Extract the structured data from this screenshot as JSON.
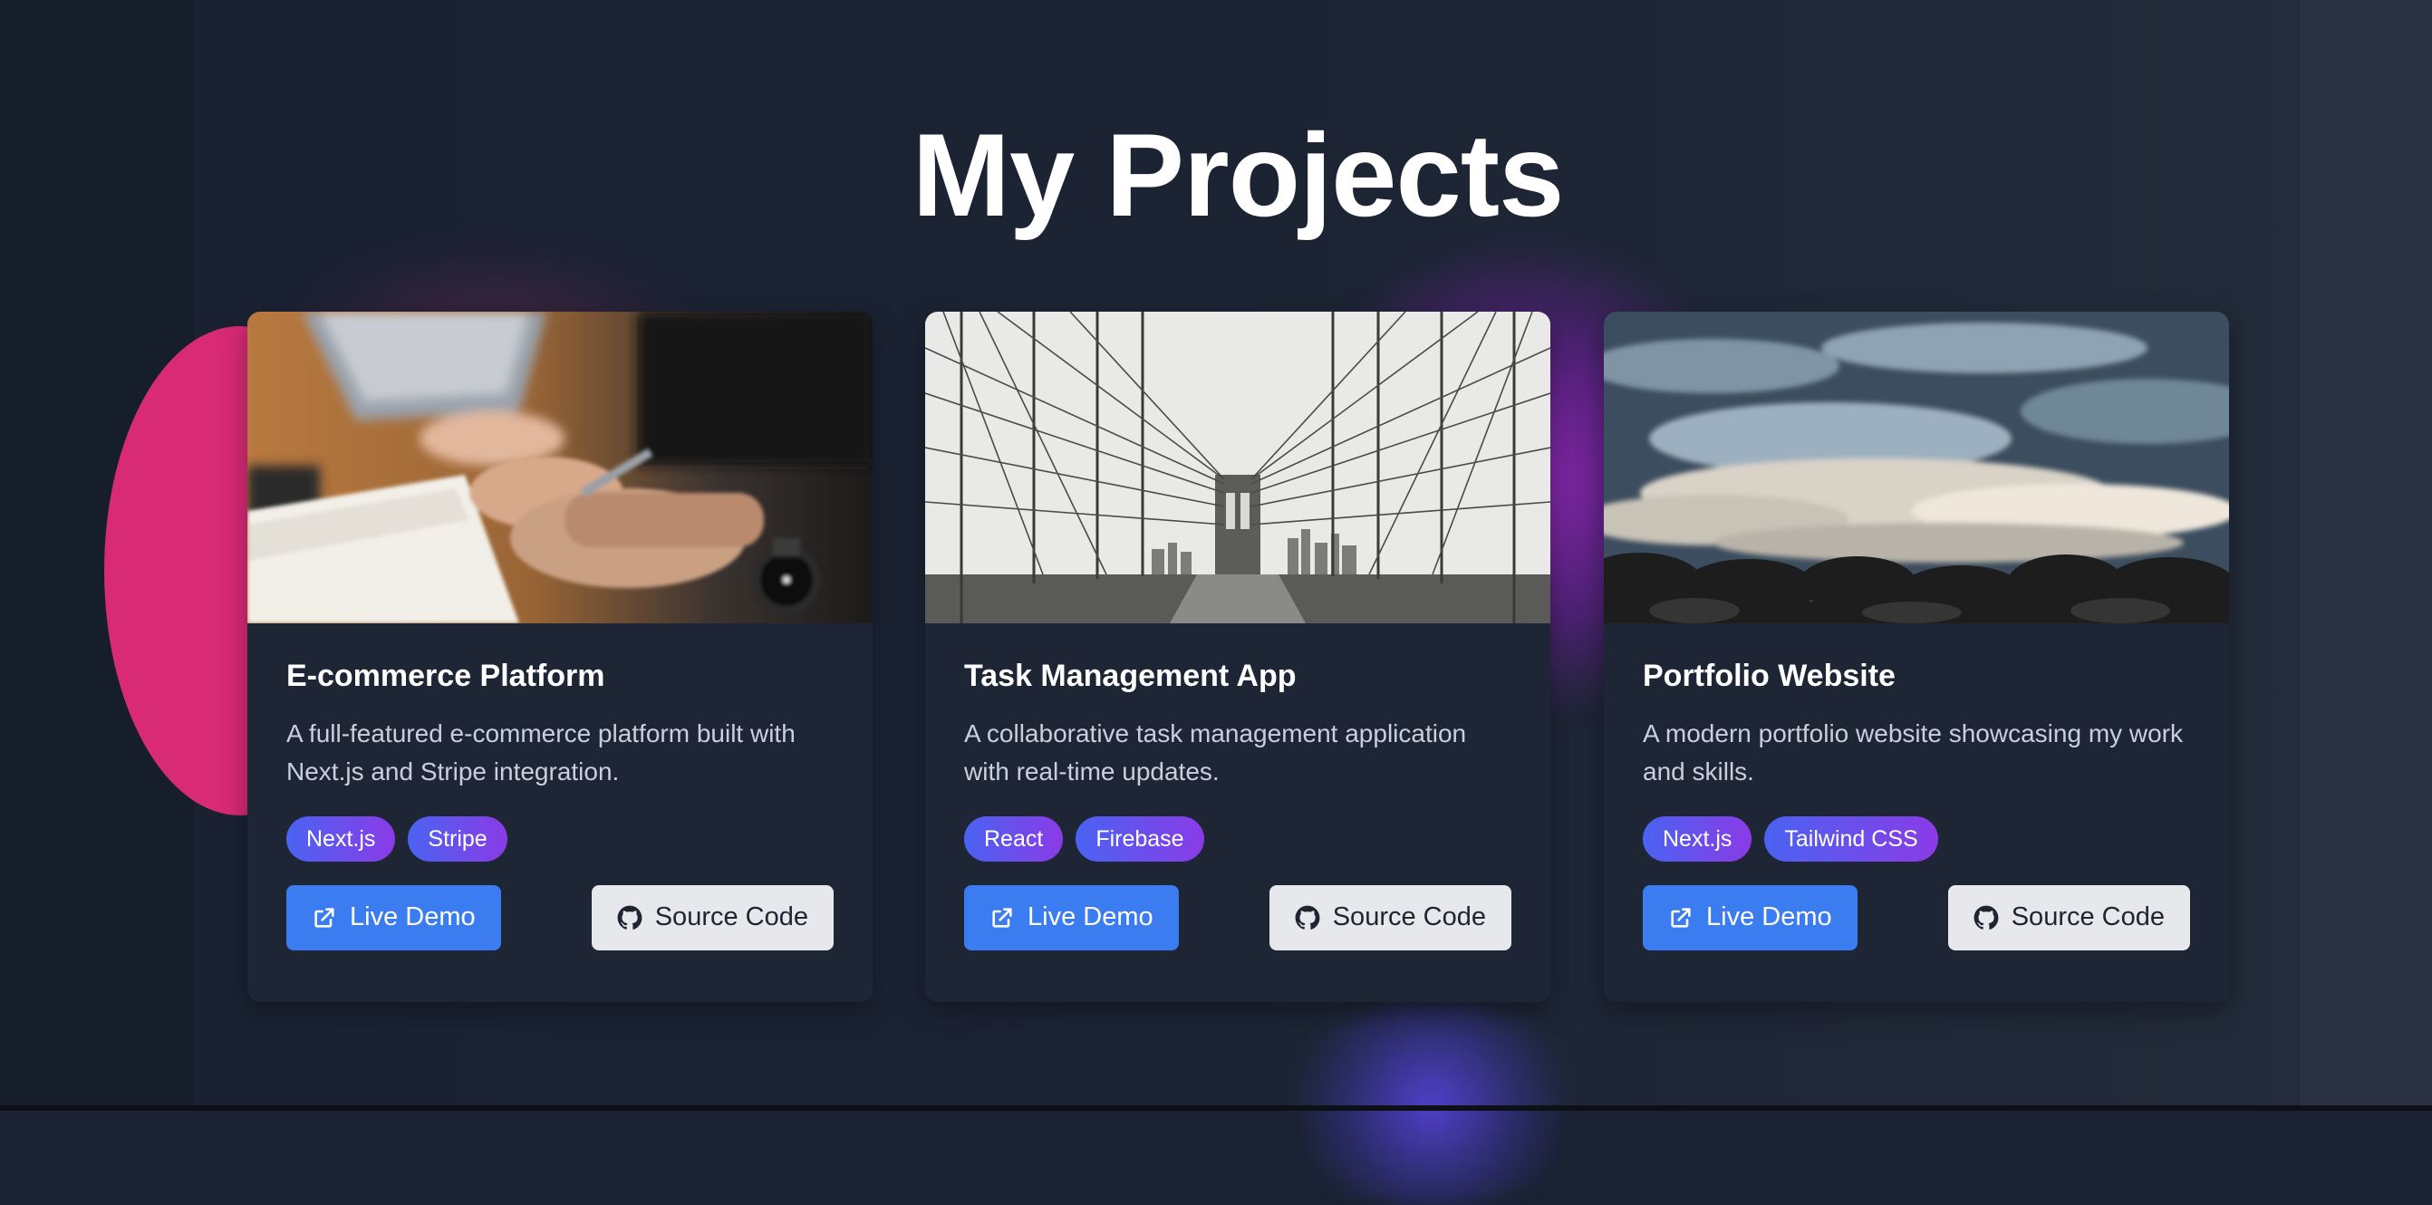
{
  "section": {
    "title": "My Projects"
  },
  "projects": [
    {
      "title": "E-commerce Platform",
      "description": "A full-featured e-commerce platform built with Next.js and Stripe integration.",
      "image_icon": "laptop-notebook-photo",
      "tags": [
        "Next.js",
        "Stripe"
      ],
      "live_demo_label": "Live Demo",
      "source_code_label": "Source Code"
    },
    {
      "title": "Task Management App",
      "description": "A collaborative task management application with real-time updates.",
      "image_icon": "suspension-bridge-photo",
      "tags": [
        "React",
        "Firebase"
      ],
      "live_demo_label": "Live Demo",
      "source_code_label": "Source Code"
    },
    {
      "title": "Portfolio Website",
      "description": "A modern portfolio website showcasing my work and skills.",
      "image_icon": "ocean-waves-photo",
      "tags": [
        "Next.js",
        "Tailwind CSS"
      ],
      "live_demo_label": "Live Demo",
      "source_code_label": "Source Code"
    }
  ],
  "icons": {
    "live_demo": "external-link-icon",
    "source_code": "github-icon"
  },
  "colors": {
    "background": "#1b2232",
    "card": "#1e2636",
    "primary_button": "#3b7cf0",
    "secondary_button": "#e6e8ec",
    "tag_gradient_start": "#4a63f2",
    "tag_gradient_end": "#8a3be6",
    "accent_pink": "#d92a76"
  }
}
